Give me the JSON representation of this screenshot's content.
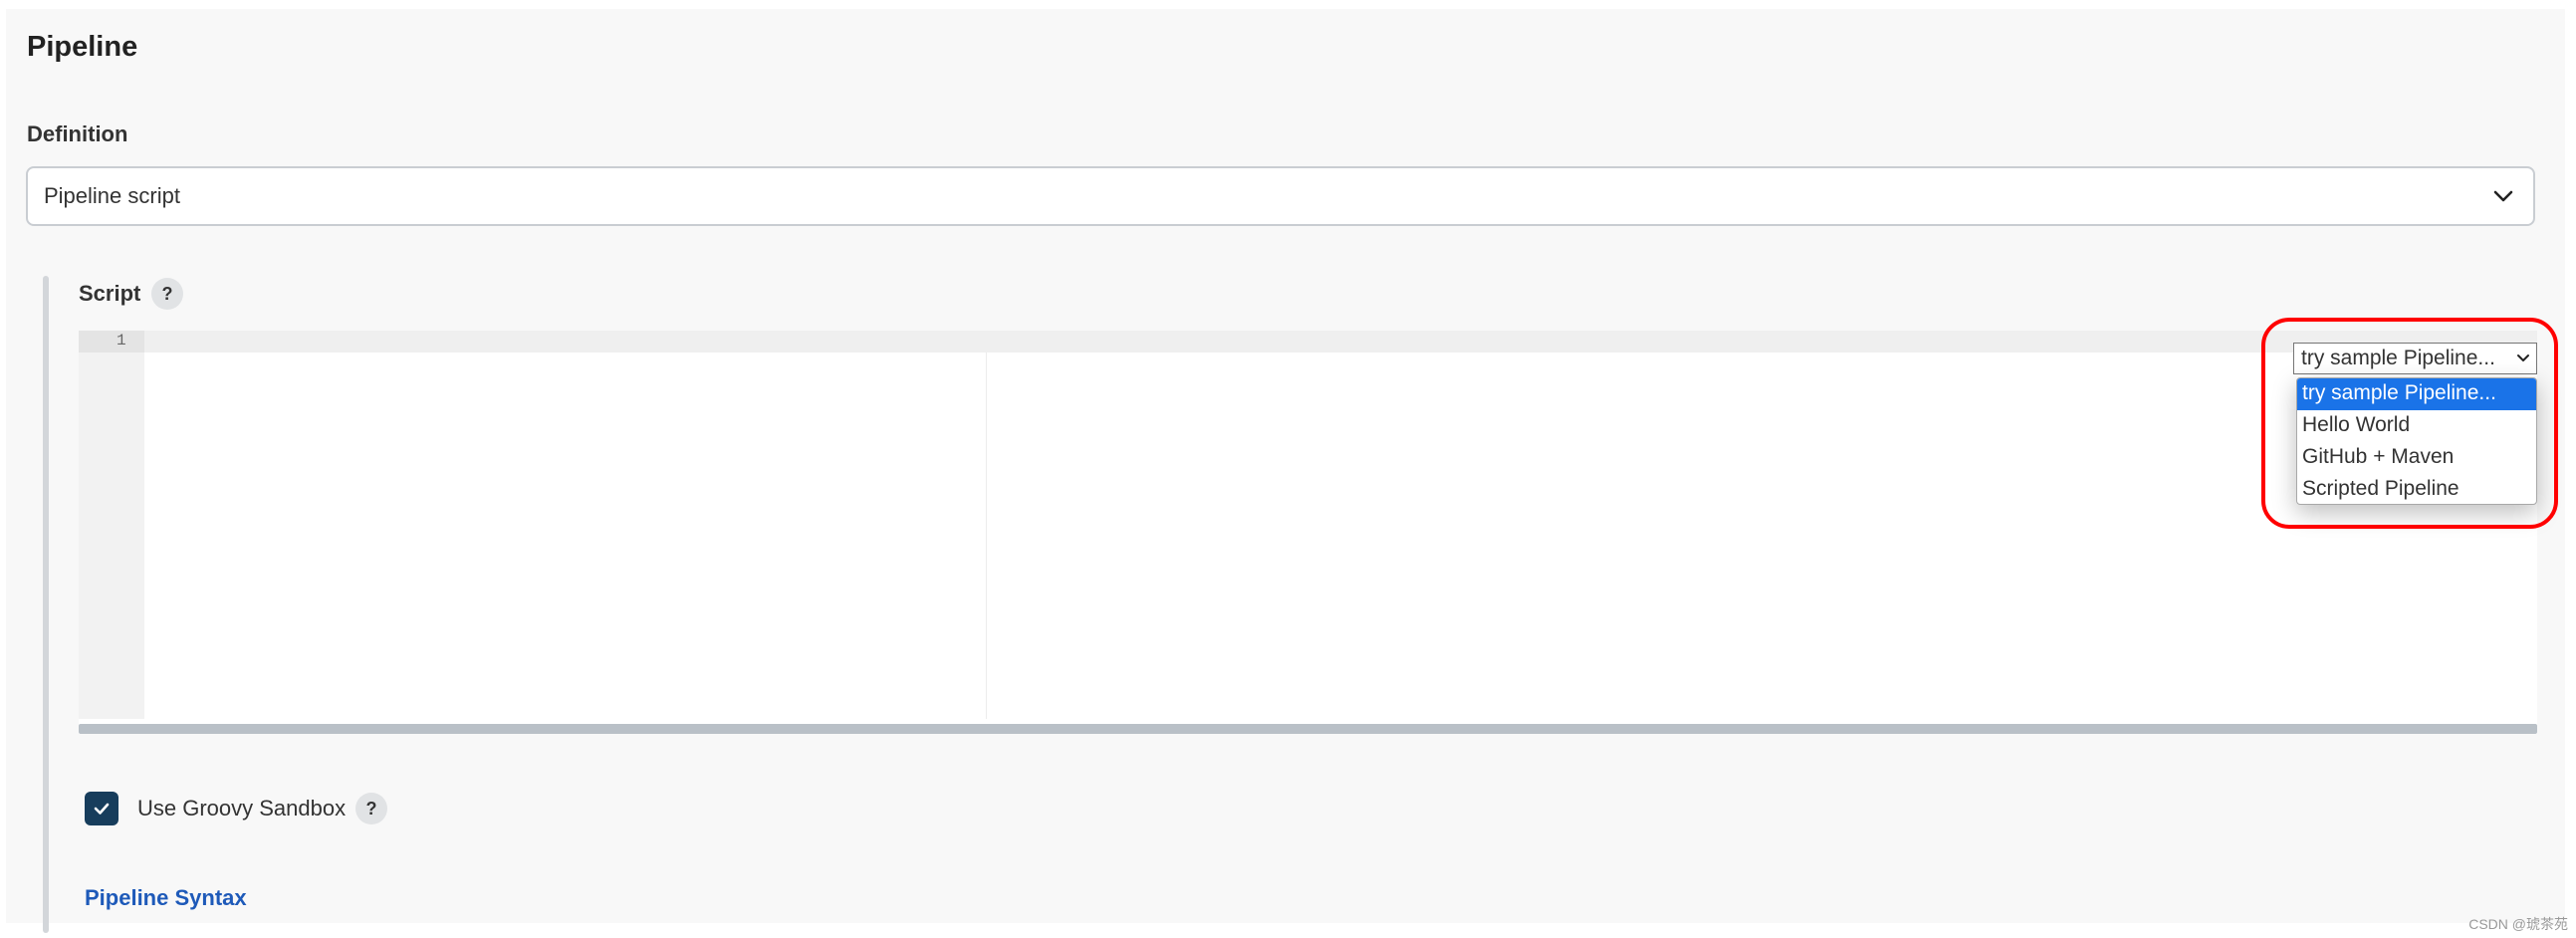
{
  "section": {
    "title": "Pipeline"
  },
  "definition": {
    "label": "Definition",
    "selected": "Pipeline script"
  },
  "script": {
    "label": "Script",
    "help": "?",
    "line_number": "1",
    "sample_select": {
      "selected": "try sample Pipeline...",
      "options": [
        "try sample Pipeline...",
        "Hello World",
        "GitHub + Maven",
        "Scripted Pipeline"
      ]
    }
  },
  "sandbox": {
    "label": "Use Groovy Sandbox",
    "help": "?",
    "checked": true
  },
  "links": {
    "pipeline_syntax": "Pipeline Syntax"
  },
  "watermark": "CSDN @琥茶苑",
  "colors": {
    "highlight": "#ff0000",
    "selected_option": "#1a73e8",
    "checkbox": "#173d5c",
    "link": "#1e5ab9"
  },
  "icons": {
    "definition_dropdown": "chevron-down-icon",
    "sample_dropdown": "chevron-down-icon",
    "checkbox": "check-icon"
  }
}
